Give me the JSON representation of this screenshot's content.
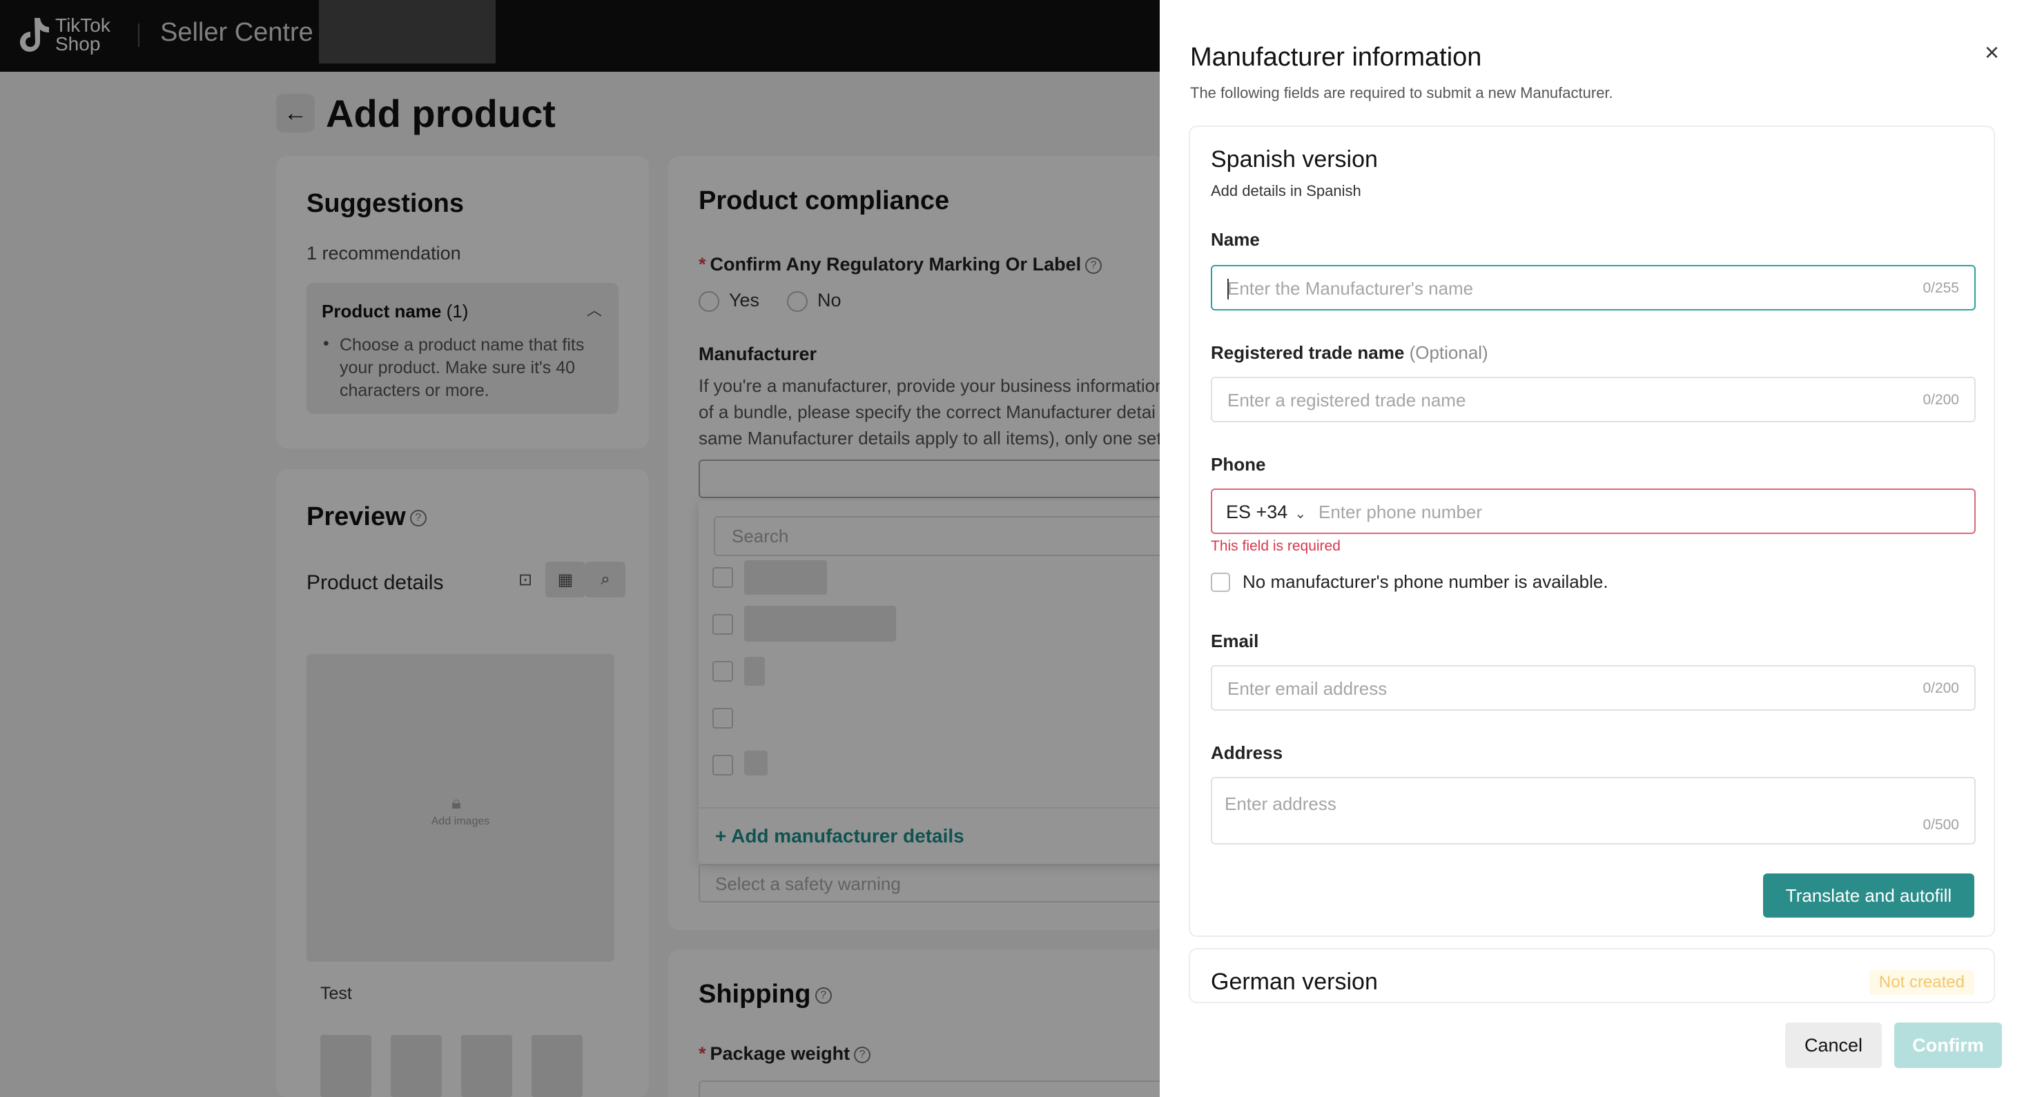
{
  "app": {
    "brand_line1": "TikTok",
    "brand_line2": "Shop",
    "title": "Seller Centre"
  },
  "page": {
    "title": "Add product"
  },
  "suggestions": {
    "title": "Suggestions",
    "count_text": "1 recommendation",
    "item_title": "Product name",
    "item_count": "(1)",
    "item_text": "Choose a product name that fits your product. Make sure it's 40 characters or more."
  },
  "preview": {
    "title": "Preview",
    "details_label": "Product details",
    "add_images": "Add images",
    "product_name": "Test"
  },
  "compliance": {
    "title": "Product compliance",
    "question": "Confirm Any Regulatory Marking Or Label",
    "option_yes": "Yes",
    "option_no": "No",
    "manufacturer_label": "Manufacturer",
    "manufacturer_help_1": "If you're a manufacturer, provide your business information",
    "manufacturer_help_2": "of a bundle, please specify the correct Manufacturer detai",
    "manufacturer_help_3": "same Manufacturer details apply to all items), only one set",
    "dropdown_search": "Search",
    "add_manufacturer": "Add manufacturer details",
    "safety_placeholder": "Select a safety warning"
  },
  "shipping": {
    "title": "Shipping",
    "package_weight": "Package weight"
  },
  "drawer": {
    "title": "Manufacturer information",
    "subtitle": "The following fields are required to submit a new Manufacturer.",
    "spanish": {
      "title": "Spanish version",
      "subtitle": "Add details in Spanish",
      "name_label": "Name",
      "name_placeholder": "Enter the Manufacturer's name",
      "name_counter": "0/255",
      "trade_label": "Registered trade name",
      "trade_optional": "(Optional)",
      "trade_placeholder": "Enter a registered trade name",
      "trade_counter": "0/200",
      "phone_label": "Phone",
      "phone_country": "ES +34",
      "phone_placeholder": "Enter phone number",
      "phone_error": "This field is required",
      "no_phone_label": "No manufacturer's phone number is available.",
      "email_label": "Email",
      "email_placeholder": "Enter email address",
      "email_counter": "0/200",
      "address_label": "Address",
      "address_placeholder": "Enter address",
      "address_counter": "0/500",
      "translate_button": "Translate and autofill"
    },
    "german": {
      "title": "German version",
      "status": "Not created"
    },
    "cancel_button": "Cancel",
    "confirm_button": "Confirm"
  },
  "colors": {
    "accent": "#2a8d8a",
    "error": "#d8374b",
    "topbar": "#121212"
  },
  "icons": [
    "tiktok-logo-icon",
    "back-arrow-icon",
    "chevron-up-icon",
    "help-icon",
    "bag-icon",
    "grid-icon",
    "search-doc-icon",
    "lock-icon",
    "plus-icon",
    "close-icon",
    "chevron-down-icon"
  ]
}
